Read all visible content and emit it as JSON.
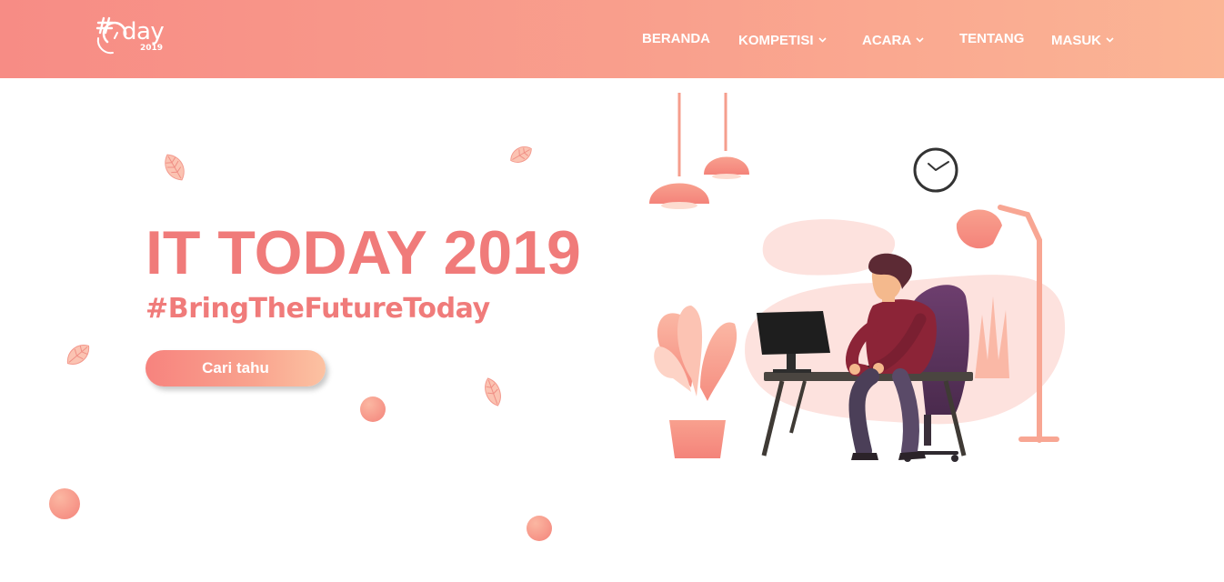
{
  "logo": {
    "word": "day",
    "year": "2019",
    "icon": "it-today-logo-icon"
  },
  "nav": {
    "items": [
      {
        "label": "BERANDA",
        "has_dropdown": false
      },
      {
        "label": "KOMPETISI",
        "has_dropdown": true
      },
      {
        "label": "ACARA",
        "has_dropdown": true
      },
      {
        "label": "TENTANG",
        "has_dropdown": false
      },
      {
        "label": "MASUK",
        "has_dropdown": true
      }
    ],
    "dropdown_icon": "chevron-down-icon"
  },
  "hero": {
    "title": "IT TODAY 2019",
    "tagline": "#BringTheFutureToday",
    "cta_label": "Cari tahu"
  },
  "colors": {
    "nav_gradient_start": "#f78c85",
    "nav_gradient_end": "#fbb595",
    "accent": "#f07b7a",
    "white": "#ffffff"
  },
  "decorations": {
    "leaf_icon": "leaf-icon",
    "dot_icon": "circle-dot",
    "illustration": "person-working-at-desk-illustration"
  }
}
